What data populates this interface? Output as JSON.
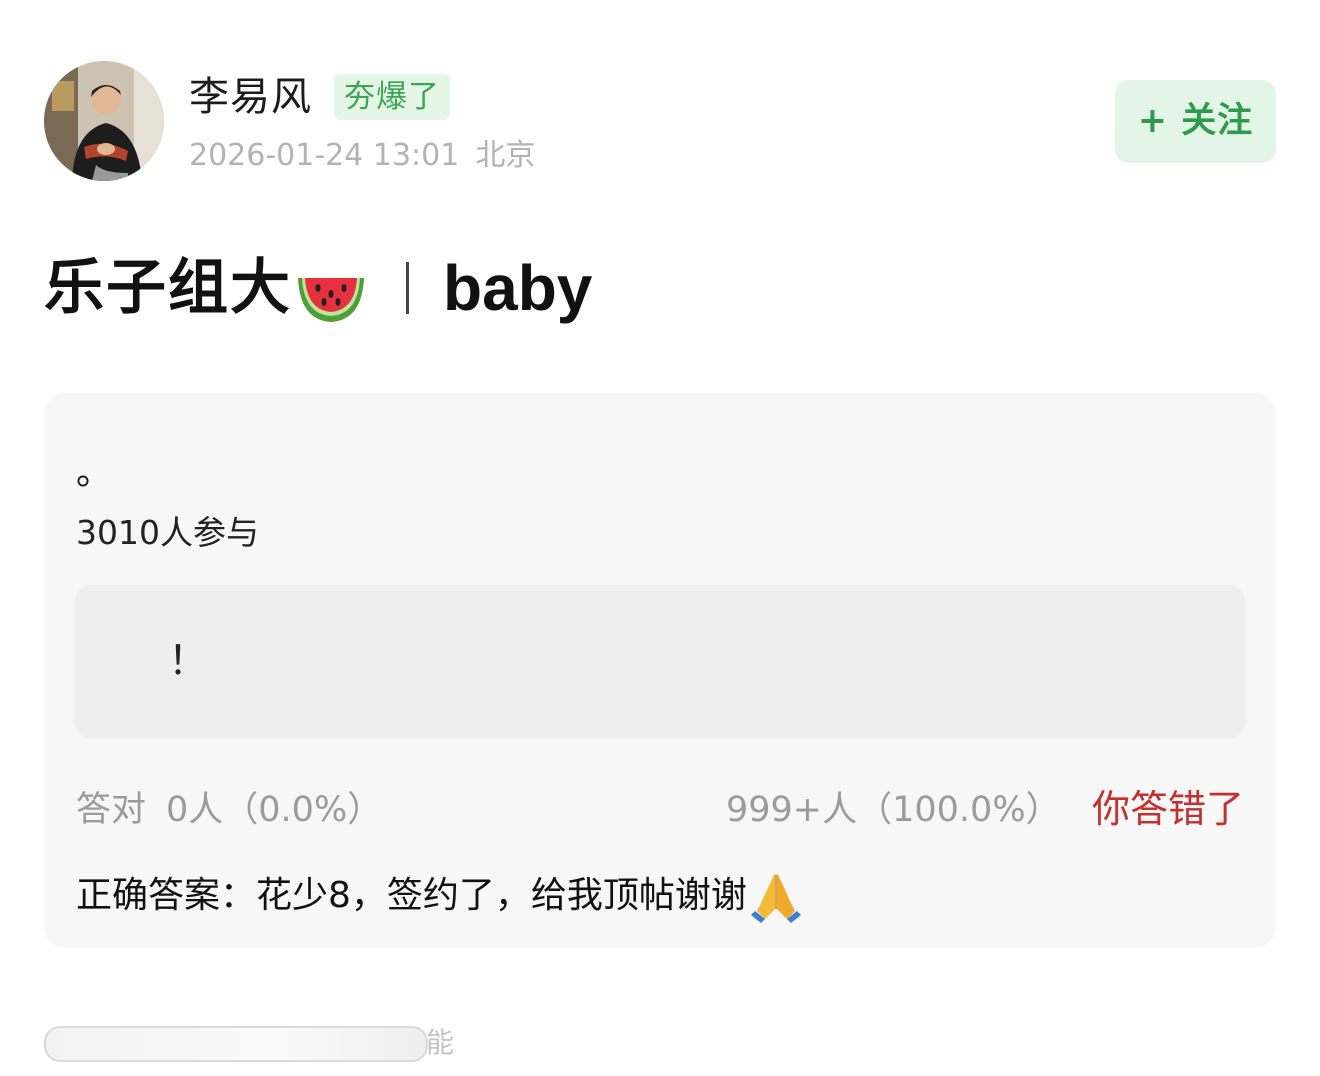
{
  "author": {
    "name": "李易风",
    "badge": "夯爆了",
    "date": "2026-01-24 13:01",
    "location": "北京",
    "avatar_icon": "person-photo",
    "follow_label": "+ 关注"
  },
  "post": {
    "title": "乐子组大",
    "title_emoji": "watermelon-emoji",
    "title_suffix": "baby"
  },
  "quiz": {
    "question": "。",
    "participants": "3010人参与",
    "option": "！",
    "stats_correct_label": "答对",
    "stats_correct_value": "0人（0.0%）",
    "stats_wrong_value": "999+人（100.0%）",
    "result": "你答错了",
    "answer_label": "正确答案：",
    "answer_text": "花少8，签约了，给我顶帖谢谢",
    "answer_emoji": "folded-hands-emoji"
  },
  "footer": {
    "text": "能"
  },
  "colors": {
    "accent_green": "#2f9a49",
    "badge_green_bg": "#e4f6e6",
    "error_red": "#c72f2f",
    "muted_gray": "#9b9b9b"
  }
}
